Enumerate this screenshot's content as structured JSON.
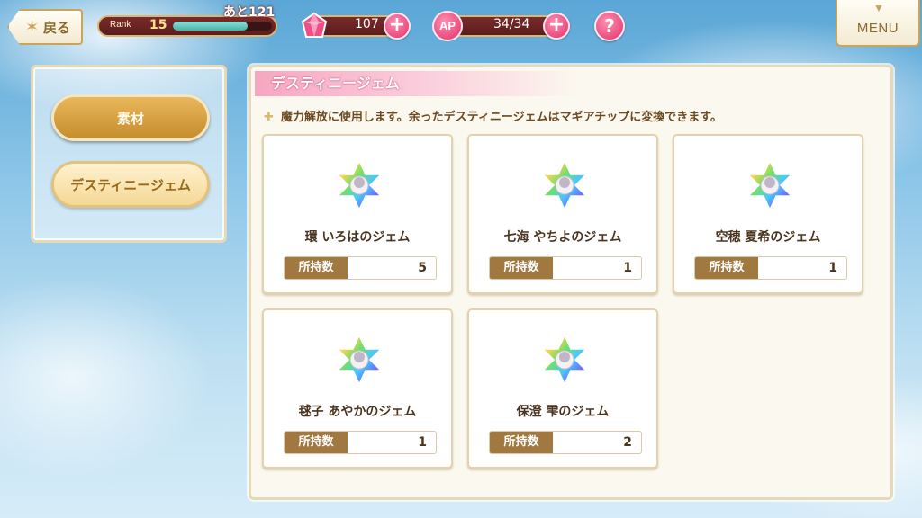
{
  "header": {
    "back_label": "戻る",
    "rank_label": "Rank",
    "rank_value": "15",
    "rank_next": "あと121",
    "rank_progress_pct": 75,
    "gems_value": "107",
    "ap_icon_label": "AP",
    "ap_value": "34/34",
    "help_label": "?",
    "menu_label": "MENU"
  },
  "sidebar": {
    "tabs": [
      {
        "label": "素材",
        "selected": false
      },
      {
        "label": "デスティニージェム",
        "selected": true
      }
    ]
  },
  "main": {
    "title": "デスティニージェム",
    "description": "魔力解放に使用します。余ったデスティニージェムはマギアチップに変換できます。",
    "count_label": "所持数",
    "cards": [
      {
        "name": "環 いろはのジェム",
        "count": "5"
      },
      {
        "name": "七海 やちよのジェム",
        "count": "1"
      },
      {
        "name": "空穂 夏希のジェム",
        "count": "1"
      },
      {
        "name": "毬子 あやかのジェム",
        "count": "1"
      },
      {
        "name": "保澄 雫のジェム",
        "count": "2"
      }
    ]
  },
  "colors": {
    "accent_pink": "#e0306a",
    "gold": "#c9a45c",
    "count_label_bg": "#a07840"
  }
}
